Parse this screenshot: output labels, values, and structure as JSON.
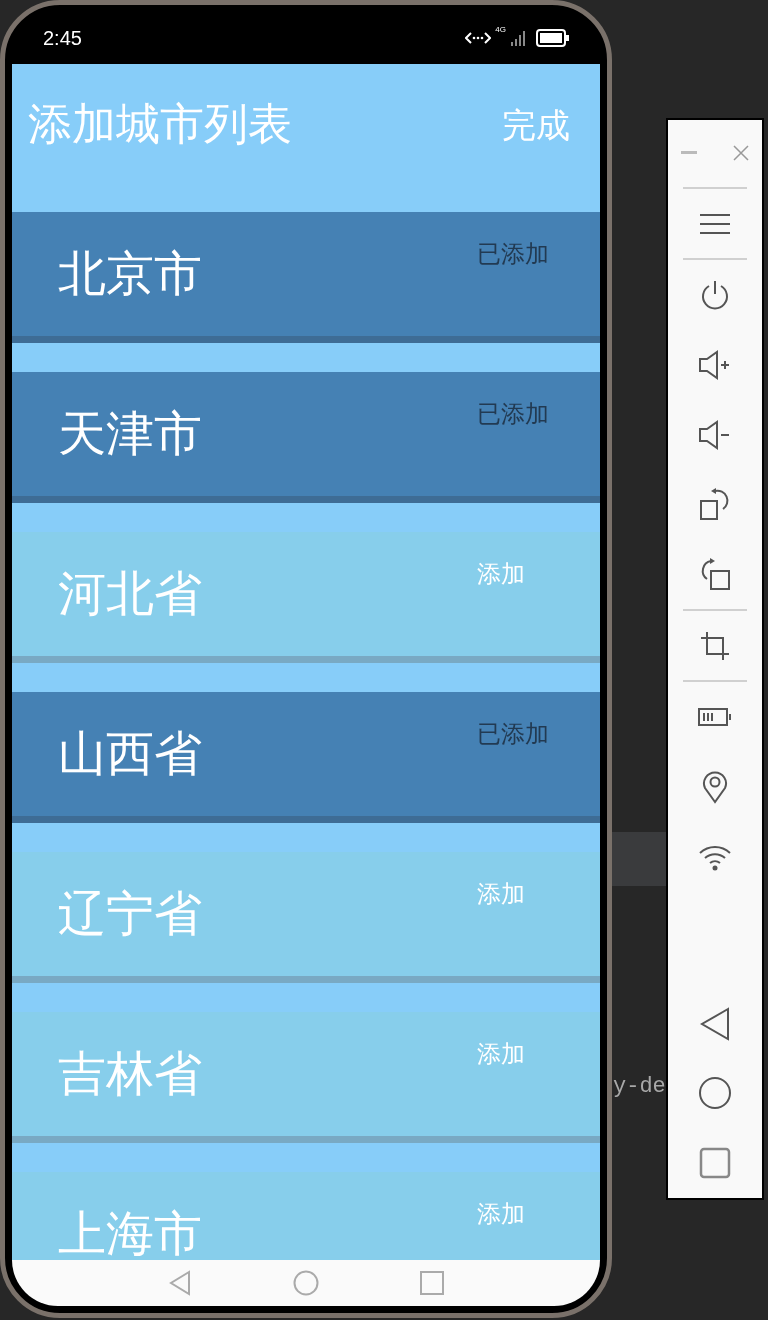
{
  "status_bar": {
    "time": "2:45",
    "network": "4G"
  },
  "header": {
    "title": "添加城市列表",
    "done_button": "完成"
  },
  "cities": [
    {
      "name": "北京市",
      "status": "已添加",
      "added": true
    },
    {
      "name": "天津市",
      "status": "已添加",
      "added": true
    },
    {
      "name": "河北省",
      "status": "添加",
      "added": false
    },
    {
      "name": "山西省",
      "status": "已添加",
      "added": true
    },
    {
      "name": "辽宁省",
      "status": "添加",
      "added": false
    },
    {
      "name": "吉林省",
      "status": "添加",
      "added": false
    },
    {
      "name": "上海市",
      "status": "添加",
      "added": false
    }
  ],
  "background_text": "y-de"
}
